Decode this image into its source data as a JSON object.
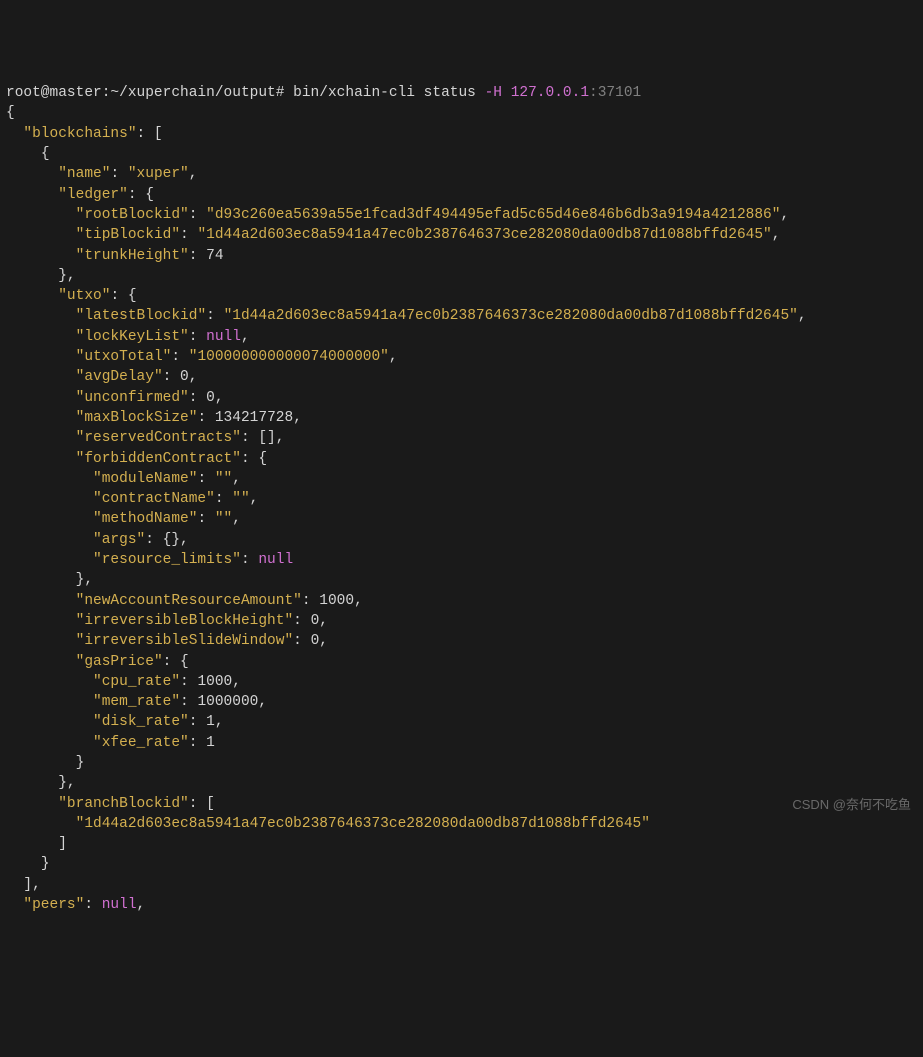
{
  "prompt": {
    "user": "root@master",
    "path": "~/xuperchain/output",
    "sep": "# ",
    "cmd": "bin/xchain-cli status ",
    "flag": "-H",
    "ip": " 127.0.0.1",
    "port": ":37101"
  },
  "json": {
    "blockchains_key": "\"blockchains\"",
    "name_key": "\"name\"",
    "name_val": "\"xuper\"",
    "ledger_key": "\"ledger\"",
    "rootBlockid_key": "\"rootBlockid\"",
    "rootBlockid_val": "\"d93c260ea5639a55e1fcad3df494495efad5c65d46e846b6db3a9194a4212886\"",
    "tipBlockid_key": "\"tipBlockid\"",
    "tipBlockid_val": "\"1d44a2d603ec8a5941a47ec0b2387646373ce282080da00db87d1088bffd2645\"",
    "trunkHeight_key": "\"trunkHeight\"",
    "trunkHeight_val": "74",
    "utxo_key": "\"utxo\"",
    "latestBlockid_key": "\"latestBlockid\"",
    "latestBlockid_val": "\"1d44a2d603ec8a5941a47ec0b2387646373ce282080da00db87d1088bffd2645\"",
    "lockKeyList_key": "\"lockKeyList\"",
    "utxoTotal_key": "\"utxoTotal\"",
    "utxoTotal_val": "\"100000000000074000000\"",
    "avgDelay_key": "\"avgDelay\"",
    "avgDelay_val": "0",
    "unconfirmed_key": "\"unconfirmed\"",
    "unconfirmed_val": "0",
    "maxBlockSize_key": "\"maxBlockSize\"",
    "maxBlockSize_val": "134217728",
    "reservedContracts_key": "\"reservedContracts\"",
    "forbiddenContract_key": "\"forbiddenContract\"",
    "moduleName_key": "\"moduleName\"",
    "moduleName_val": "\"\"",
    "contractName_key": "\"contractName\"",
    "contractName_val": "\"\"",
    "methodName_key": "\"methodName\"",
    "methodName_val": "\"\"",
    "args_key": "\"args\"",
    "resource_limits_key": "\"resource_limits\"",
    "newAccountResourceAmount_key": "\"newAccountResourceAmount\"",
    "newAccountResourceAmount_val": "1000",
    "irreversibleBlockHeight_key": "\"irreversibleBlockHeight\"",
    "irreversibleBlockHeight_val": "0",
    "irreversibleSlideWindow_key": "\"irreversibleSlideWindow\"",
    "irreversibleSlideWindow_val": "0",
    "gasPrice_key": "\"gasPrice\"",
    "cpu_rate_key": "\"cpu_rate\"",
    "cpu_rate_val": "1000",
    "mem_rate_key": "\"mem_rate\"",
    "mem_rate_val": "1000000",
    "disk_rate_key": "\"disk_rate\"",
    "disk_rate_val": "1",
    "xfee_rate_key": "\"xfee_rate\"",
    "xfee_rate_val": "1",
    "branchBlockid_key": "\"branchBlockid\"",
    "branchBlockid_val": "\"1d44a2d603ec8a5941a47ec0b2387646373ce282080da00db87d1088bffd2645\"",
    "peers_key": "\"peers\"",
    "null_val": "null"
  },
  "watermark": "CSDN @奈何不吃鱼"
}
